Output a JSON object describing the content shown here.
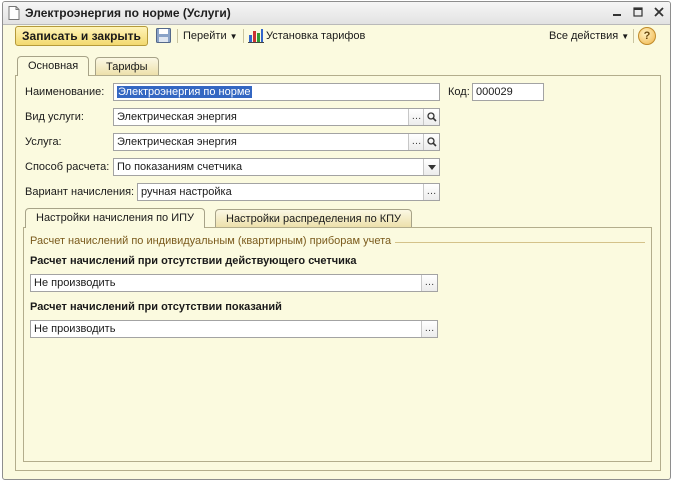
{
  "window": {
    "title": "Электроэнергия по норме (Услуги)"
  },
  "toolbar": {
    "save_close_label": "Записать и закрыть",
    "goto_label": "Перейти",
    "tariffs_label": "Установка тарифов",
    "all_actions_label": "Все действия",
    "help_label": "?"
  },
  "tabs": [
    {
      "label": "Основная"
    },
    {
      "label": "Тарифы"
    }
  ],
  "form": {
    "name_label": "Наименование:",
    "name_value": "Электроэнергия по норме",
    "code_label": "Код:",
    "code_value": "000029",
    "service_type_label": "Вид услуги:",
    "service_type_value": "Электрическая энергия",
    "service_label": "Услуга:",
    "service_value": "Электрическая энергия",
    "calc_method_label": "Способ расчета:",
    "calc_method_value": "По показаниям счетчика",
    "accrual_variant_label": "Вариант начисления:",
    "accrual_variant_value": "ручная настройка"
  },
  "subtabs": [
    {
      "label": "Настройки начисления по ИПУ"
    },
    {
      "label": "Настройки распределения по КПУ"
    }
  ],
  "ipu": {
    "group_title": "Расчет начислений по индивидуальным (квартирным) приборам учета",
    "no_meter_label": "Расчет начислений при отсутствии действующего счетчика",
    "no_meter_value": "Не производить",
    "no_readings_label": "Расчет начислений при отсутствии показаний",
    "no_readings_value": "Не производить"
  },
  "icons": {
    "document": "document-icon",
    "minimize": "minimize-icon",
    "maximize": "maximize-icon",
    "close": "close-icon",
    "save": "floppy-disk-icon",
    "chart": "bar-chart-icon",
    "search": "search-icon",
    "ellipsis": "ellipsis-icon",
    "dropdown": "chevron-down-icon"
  },
  "colors": {
    "window_bg": "#fbfadf",
    "save_button": "#f2d96f",
    "selection": "#3467c2",
    "group_title": "#7a5a1c"
  }
}
